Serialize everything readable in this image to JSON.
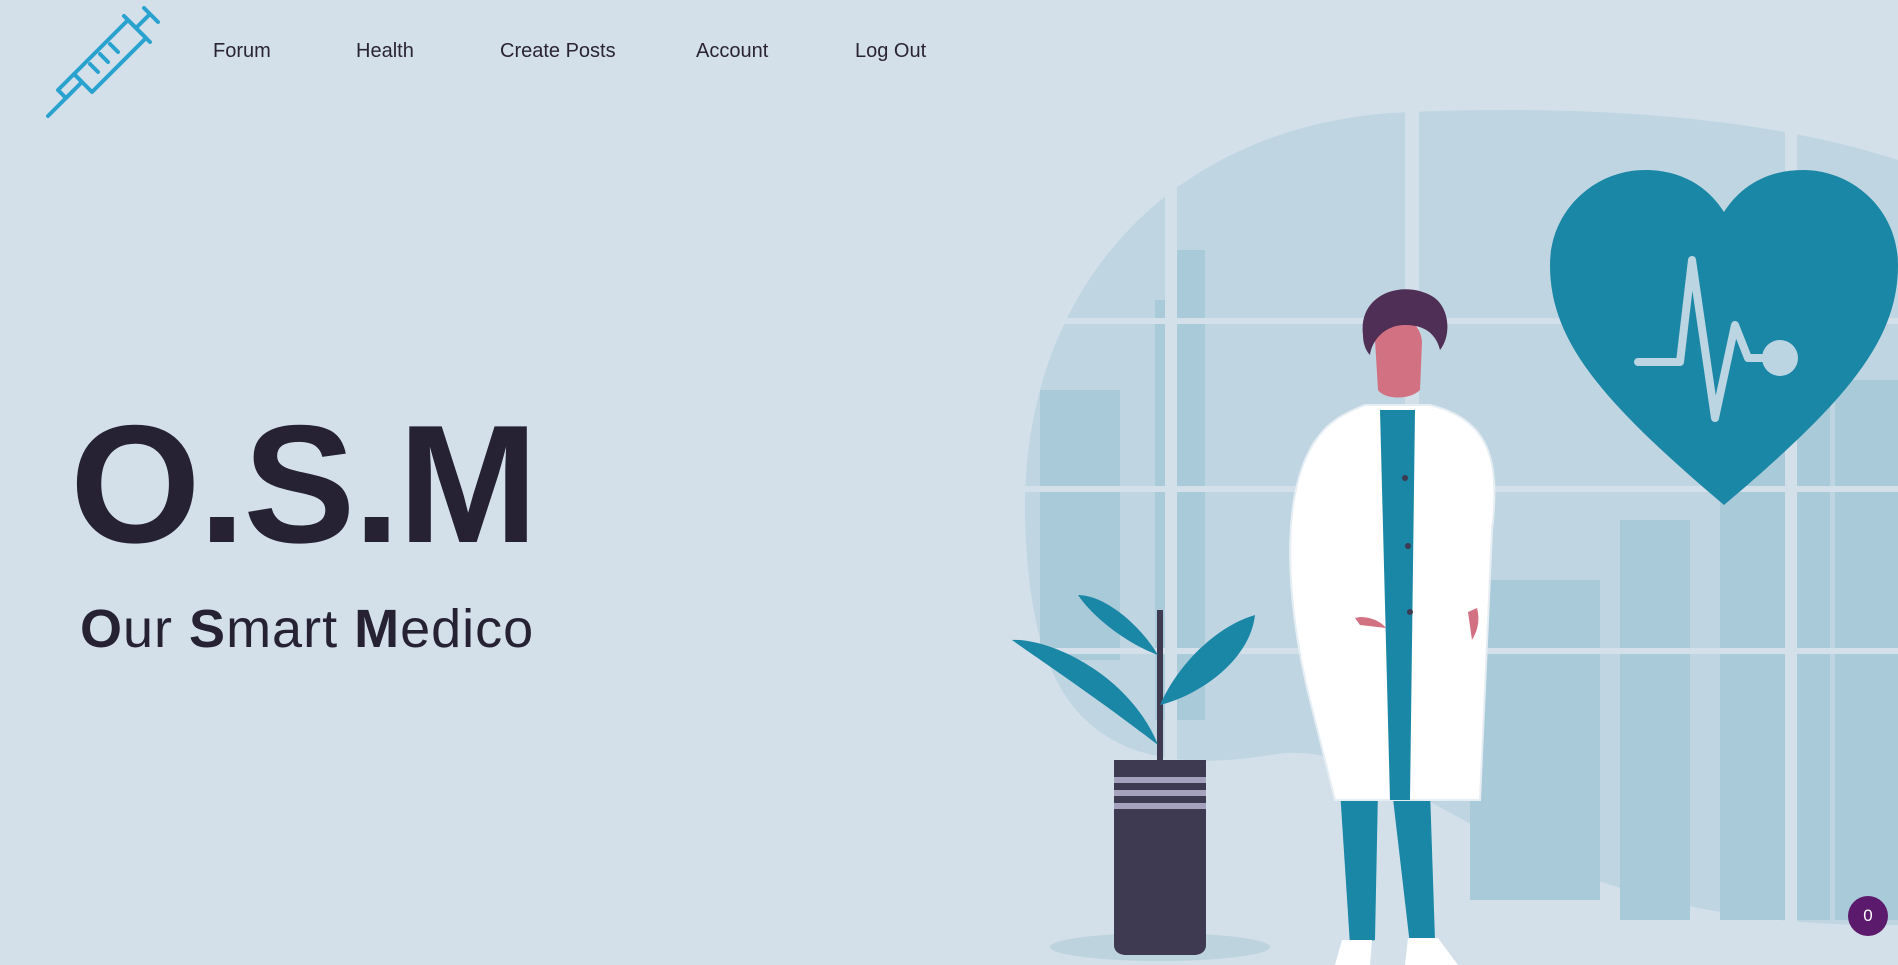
{
  "brand": {
    "logo_icon": "syringe-icon",
    "logo_color": "#2aa2cf"
  },
  "nav": {
    "items": [
      {
        "label": "Forum"
      },
      {
        "label": "Health"
      },
      {
        "label": "Create Posts"
      },
      {
        "label": "Account"
      },
      {
        "label": "Log Out"
      }
    ]
  },
  "hero": {
    "title": "O.S.M",
    "subtitle": {
      "w1_initial": "O",
      "w1_rest": "ur ",
      "w2_initial": "S",
      "w2_rest": "mart ",
      "w3_initial": "M",
      "w3_rest": "edico"
    }
  },
  "badge": {
    "count": "0"
  },
  "colors": {
    "background": "#d3e0ea",
    "text": "#262234",
    "accent_teal": "#1a87a6",
    "badge": "#5b1a6b"
  }
}
